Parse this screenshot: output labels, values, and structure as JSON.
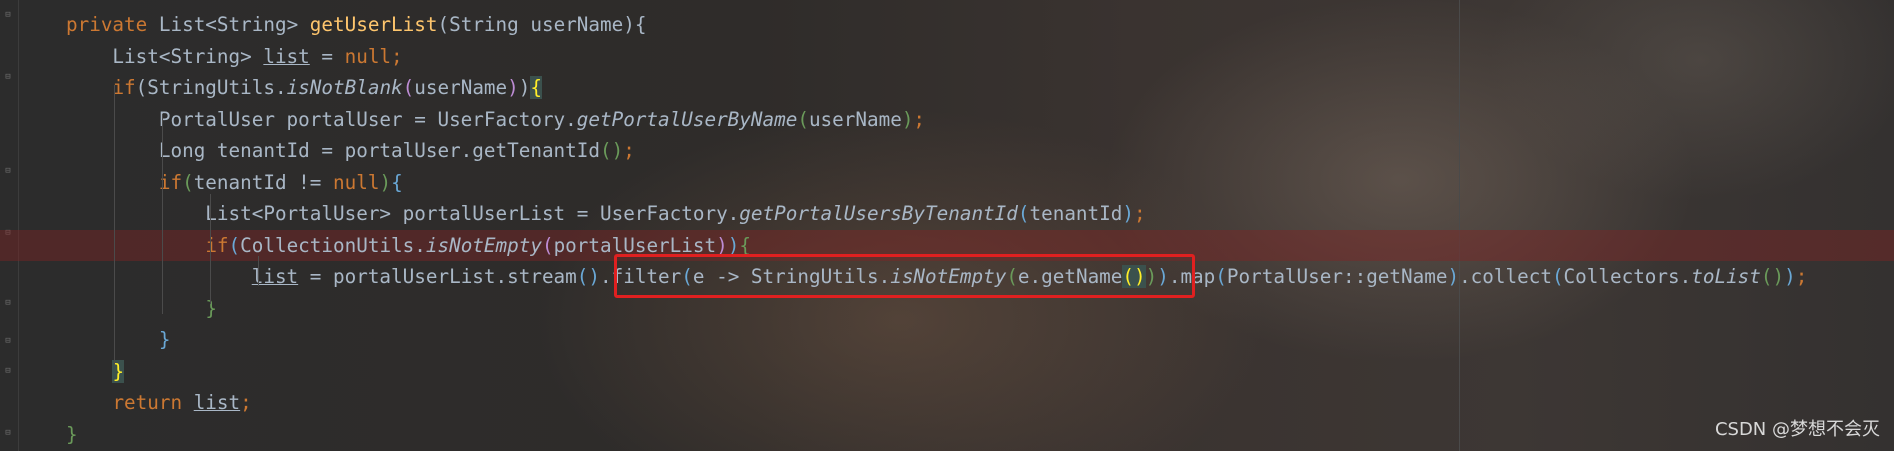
{
  "editor": {
    "lines": [
      {
        "tokens": [
          {
            "t": "private ",
            "c": "kw"
          },
          {
            "t": "List<String> "
          },
          {
            "t": "getUserList",
            "c": "fn"
          },
          {
            "t": "(String userName){"
          }
        ]
      },
      {
        "tokens": [
          {
            "t": "    List<String> "
          },
          {
            "t": "list",
            "c": "ul"
          },
          {
            "t": " = "
          },
          {
            "t": "null",
            "c": "kw"
          },
          {
            "t": ";",
            "c": "kw"
          }
        ]
      },
      {
        "tokens": [
          {
            "t": "    "
          },
          {
            "t": "if",
            "c": "kw"
          },
          {
            "t": "(StringUtils."
          },
          {
            "t": "isNotBlank",
            "c": "it"
          },
          {
            "t": "(",
            "c": "b1"
          },
          {
            "t": "userName"
          },
          {
            "t": ")",
            "c": "b1"
          },
          {
            "t": ")"
          },
          {
            "t": "{",
            "c": "bracket-match"
          }
        ]
      },
      {
        "tokens": [
          {
            "t": "        PortalUser portalUser = UserFactory."
          },
          {
            "t": "getPortalUserByName",
            "c": "it"
          },
          {
            "t": "(",
            "c": "b3"
          },
          {
            "t": "userName"
          },
          {
            "t": ")",
            "c": "b3"
          },
          {
            "t": ";",
            "c": "kw"
          }
        ]
      },
      {
        "tokens": [
          {
            "t": "        Long tenantId = portalUser.getTenantId"
          },
          {
            "t": "()",
            "c": "b3"
          },
          {
            "t": ";",
            "c": "kw"
          }
        ]
      },
      {
        "tokens": [
          {
            "t": "        "
          },
          {
            "t": "if",
            "c": "kw"
          },
          {
            "t": "(",
            "c": "b3"
          },
          {
            "t": "tenantId != "
          },
          {
            "t": "null",
            "c": "kw"
          },
          {
            "t": ")",
            "c": "b3"
          },
          {
            "t": "{",
            "c": "b2"
          }
        ]
      },
      {
        "tokens": [
          {
            "t": "            List<PortalUser> portalUserList = UserFactory."
          },
          {
            "t": "getPortalUsersByTenantId",
            "c": "it"
          },
          {
            "t": "(",
            "c": "b2"
          },
          {
            "t": "tenantId"
          },
          {
            "t": ")",
            "c": "b2"
          },
          {
            "t": ";",
            "c": "kw"
          }
        ]
      },
      {
        "error": true,
        "tokens": [
          {
            "t": "            "
          },
          {
            "t": "if",
            "c": "kw"
          },
          {
            "t": "(",
            "c": "b2"
          },
          {
            "t": "CollectionUtils."
          },
          {
            "t": "isNotEmpty",
            "c": "it"
          },
          {
            "t": "(",
            "c": "b1"
          },
          {
            "t": "portalUserList"
          },
          {
            "t": ")",
            "c": "b1"
          },
          {
            "t": ")",
            "c": "b2"
          },
          {
            "t": "{",
            "c": "b3"
          }
        ]
      },
      {
        "tokens": [
          {
            "t": "                "
          },
          {
            "t": "list",
            "c": "ul"
          },
          {
            "t": " = portalUserList.stream"
          },
          {
            "t": "()",
            "c": "b2"
          },
          {
            "t": ".filter"
          },
          {
            "t": "(",
            "c": "b2"
          },
          {
            "t": "e -> StringUtils."
          },
          {
            "t": "isNotEmpty",
            "c": "it"
          },
          {
            "t": "(",
            "c": "b3"
          },
          {
            "t": "e.getName"
          },
          {
            "t": "()",
            "c": "bracket-match"
          },
          {
            "t": ")",
            "c": "b3"
          },
          {
            "t": ")",
            "c": "b2"
          },
          {
            "t": ".map"
          },
          {
            "t": "(",
            "c": "b2"
          },
          {
            "t": "PortalUser::getName"
          },
          {
            "t": ")",
            "c": "b2"
          },
          {
            "t": ".collect"
          },
          {
            "t": "(",
            "c": "b2"
          },
          {
            "t": "Collectors."
          },
          {
            "t": "toList",
            "c": "it"
          },
          {
            "t": "()",
            "c": "b3"
          },
          {
            "t": ")",
            "c": "b2"
          },
          {
            "t": ";",
            "c": "kw"
          }
        ]
      },
      {
        "tokens": [
          {
            "t": "            "
          },
          {
            "t": "}",
            "c": "b3"
          }
        ]
      },
      {
        "tokens": [
          {
            "t": "        "
          },
          {
            "t": "}",
            "c": "b2"
          }
        ]
      },
      {
        "tokens": [
          {
            "t": "    "
          },
          {
            "t": "}",
            "c": "bracket-match"
          }
        ]
      },
      {
        "tokens": [
          {
            "t": "    "
          },
          {
            "t": "return ",
            "c": "kw"
          },
          {
            "t": "list",
            "c": "ul"
          },
          {
            "t": ";",
            "c": "kw"
          }
        ]
      },
      {
        "tokens": [
          {
            "t": "}",
            "c": "b3"
          }
        ]
      }
    ]
  },
  "annotation": {
    "highlighted_text": ".filter(e -> StringUtils.isNotEmpty(e.getName()))",
    "box_color": "#e02020"
  },
  "watermark": "CSDN @梦想不会灭",
  "colors": {
    "keyword": "#cc7832",
    "method_decl": "#ffc66d",
    "plain": "#a9b7c6",
    "error_line_bg": "#822424"
  }
}
